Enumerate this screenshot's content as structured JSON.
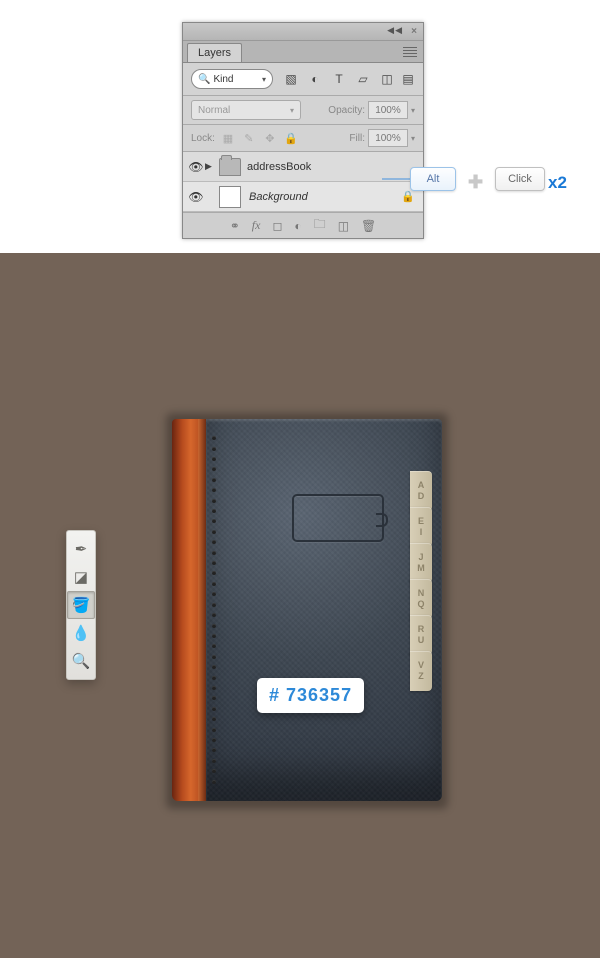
{
  "panel": {
    "tab": "Layers",
    "filter_kind": "Kind",
    "blend_mode": "Normal",
    "opacity_label": "Opacity:",
    "opacity_value": "100%",
    "lock_label": "Lock:",
    "fill_label": "Fill:",
    "fill_value": "100%"
  },
  "layers": [
    {
      "type": "group",
      "name": "addressBook"
    },
    {
      "type": "bg",
      "name": "Background"
    }
  ],
  "callout": {
    "key1": "Alt",
    "key2": "Click",
    "multiplier": "x2"
  },
  "hex": "# 736357",
  "book_tabs": [
    "A",
    "D",
    "E",
    "I",
    "J",
    "M",
    "N",
    "Q",
    "R",
    "U",
    "V",
    "Z"
  ],
  "filter_icons": [
    "image",
    "adjust",
    "text",
    "shape",
    "smart",
    "artboard"
  ],
  "mini_tools": [
    "gradient",
    "eraser",
    "bucket",
    "blur",
    "dodge"
  ],
  "footer_icons": [
    "link",
    "fx",
    "mask",
    "adjust",
    "group",
    "new",
    "trash"
  ]
}
